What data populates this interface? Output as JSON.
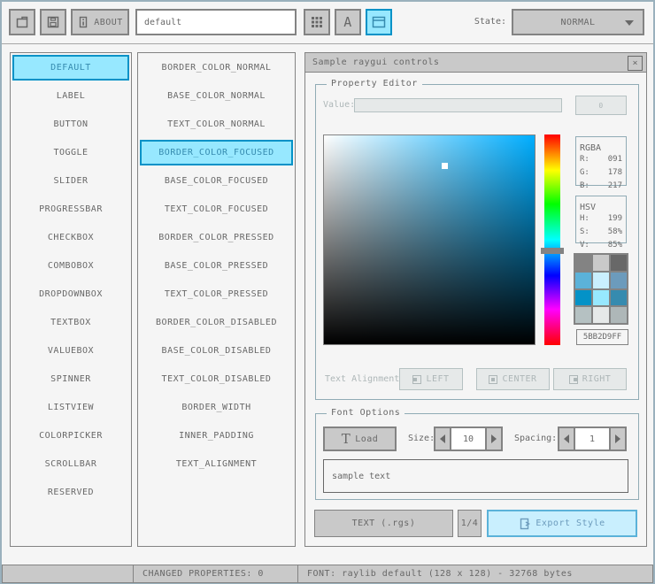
{
  "colors": {
    "accent": "#5bb2d9",
    "selected_bg": "#97e8ff",
    "selected_border": "#0492c7",
    "selected_text": "#368baf",
    "normal_bg": "#c9c9c9",
    "normal_border": "#838383",
    "normal_text": "#686868",
    "disabled_bg": "#e6e9e9",
    "disabled_border": "#b5c1c2",
    "disabled_text": "#aeb7b8",
    "focused_bg": "#c9effe",
    "background": "#f5f5f5"
  },
  "icons": {
    "new_file": "folder-icon",
    "save": "floppy-icon",
    "about": "info-icon",
    "grid": "grid-dots-icon",
    "font": "A",
    "style_table": "window-icon",
    "close": "×",
    "dropdown": "chevron-down",
    "load_font": "T",
    "export": "export-file-icon"
  },
  "toolbar": {
    "about_label": "ABOUT",
    "style_name_value": "default",
    "state_label": "State:",
    "state_value": "NORMAL"
  },
  "controls_list": {
    "items": [
      {
        "label": "DEFAULT",
        "selected": true
      },
      {
        "label": "LABEL"
      },
      {
        "label": "BUTTON"
      },
      {
        "label": "TOGGLE"
      },
      {
        "label": "SLIDER"
      },
      {
        "label": "PROGRESSBAR"
      },
      {
        "label": "CHECKBOX"
      },
      {
        "label": "COMBOBOX"
      },
      {
        "label": "DROPDOWNBOX"
      },
      {
        "label": "TEXTBOX"
      },
      {
        "label": "VALUEBOX"
      },
      {
        "label": "SPINNER"
      },
      {
        "label": "LISTVIEW"
      },
      {
        "label": "COLORPICKER"
      },
      {
        "label": "SCROLLBAR"
      },
      {
        "label": "RESERVED"
      }
    ]
  },
  "properties_list": {
    "items": [
      {
        "label": "BORDER_COLOR_NORMAL"
      },
      {
        "label": "BASE_COLOR_NORMAL"
      },
      {
        "label": "TEXT_COLOR_NORMAL"
      },
      {
        "label": "BORDER_COLOR_FOCUSED",
        "selected": true
      },
      {
        "label": "BASE_COLOR_FOCUSED"
      },
      {
        "label": "TEXT_COLOR_FOCUSED"
      },
      {
        "label": "BORDER_COLOR_PRESSED"
      },
      {
        "label": "BASE_COLOR_PRESSED"
      },
      {
        "label": "TEXT_COLOR_PRESSED"
      },
      {
        "label": "BORDER_COLOR_DISABLED"
      },
      {
        "label": "BASE_COLOR_DISABLED"
      },
      {
        "label": "TEXT_COLOR_DISABLED"
      },
      {
        "label": "BORDER_WIDTH"
      },
      {
        "label": "INNER_PADDING"
      },
      {
        "label": "TEXT_ALIGNMENT"
      }
    ]
  },
  "sample_window": {
    "title": "Sample raygui controls",
    "property_editor": {
      "title": "Property Editor",
      "value_label": "Value:",
      "value_input_value": "",
      "value_button_label": "0",
      "rgba": {
        "title": "RGBA",
        "rows": [
          {
            "k": "R:",
            "v": "091"
          },
          {
            "k": "G:",
            "v": "178"
          },
          {
            "k": "B:",
            "v": "217"
          }
        ]
      },
      "hsv": {
        "title": "HSV",
        "rows": [
          {
            "k": "H:",
            "v": "199"
          },
          {
            "k": "S:",
            "v": "58%"
          },
          {
            "k": "V:",
            "v": "85%"
          }
        ]
      },
      "palette": [
        "#838383",
        "#c9c9c9",
        "#686868",
        "#5bb2d9",
        "#c9effe",
        "#6c9bbc",
        "#0492c7",
        "#97e8ff",
        "#368baf",
        "#b5c1c2",
        "#e6e9e9",
        "#aeb7b8"
      ],
      "hex_value": "5BB2D9FF",
      "text_alignment_label": "Text Alignment:",
      "align_left_label": "LEFT",
      "align_center_label": "CENTER",
      "align_right_label": "RIGHT"
    },
    "font_options": {
      "title": "Font Options",
      "load_label": "Load",
      "size_label": "Size:",
      "size_value": "10",
      "spacing_label": "Spacing:",
      "spacing_value": "1",
      "sample_text": "sample text"
    },
    "footer": {
      "text_format_label": "TEXT (.rgs)",
      "pager_label": "1/4",
      "export_label": "Export Style"
    }
  },
  "picker": {
    "selected_hex": "5BB2D9FF",
    "hue": 199,
    "saturation_pct": 58,
    "value_pct": 85,
    "r": 91,
    "g": 178,
    "b": 217
  },
  "statusbar": {
    "changed_properties": "CHANGED PROPERTIES: 0",
    "font_info": "FONT: raylib default (128 x 128) - 32768 bytes"
  }
}
